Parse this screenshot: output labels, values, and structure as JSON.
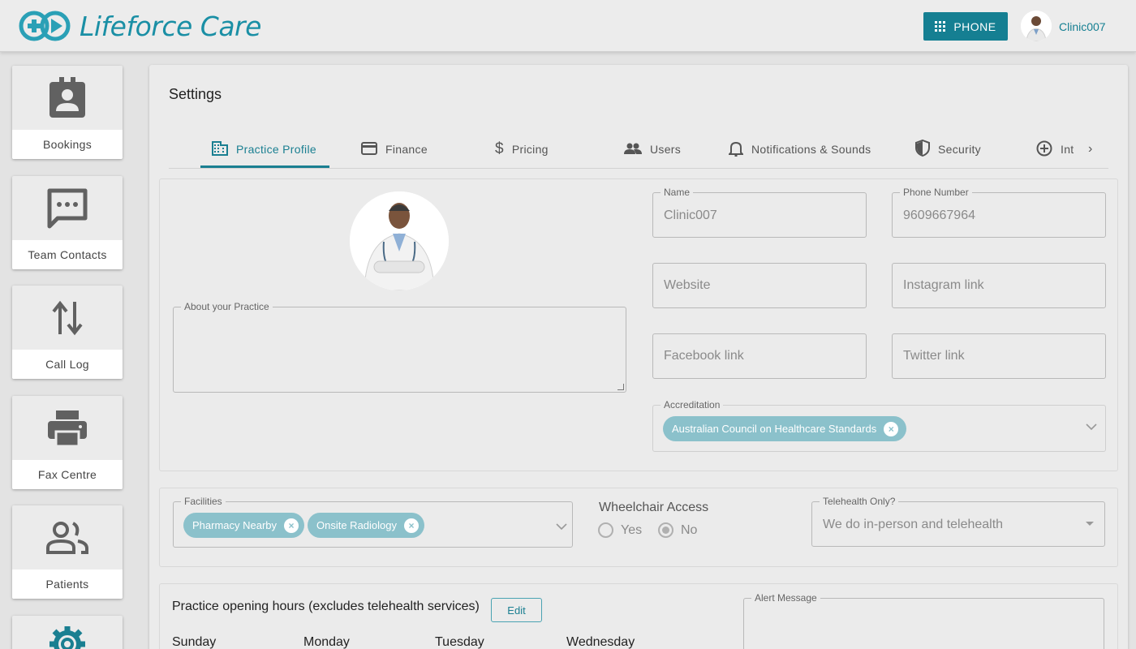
{
  "header": {
    "brand": "Lifeforce Care",
    "phone_label": "PHONE",
    "user_name": "Clinic007"
  },
  "sidebar": {
    "items": [
      {
        "label": "Bookings",
        "icon": "contact-card-icon"
      },
      {
        "label": "Team Contacts",
        "icon": "chat-bubble-icon"
      },
      {
        "label": "Call Log",
        "icon": "swap-vertical-icon"
      },
      {
        "label": "Fax Centre",
        "icon": "printer-icon"
      },
      {
        "label": "Patients",
        "icon": "people-icon"
      },
      {
        "label": "",
        "icon": "gear-icon"
      }
    ]
  },
  "settings": {
    "title": "Settings",
    "tabs": [
      {
        "label": "Practice Profile",
        "icon": "building-icon",
        "active": true
      },
      {
        "label": "Finance",
        "icon": "credit-card-icon"
      },
      {
        "label": "Pricing",
        "icon": "dollar-icon"
      },
      {
        "label": "Users",
        "icon": "users-icon"
      },
      {
        "label": "Notifications & Sounds",
        "icon": "bell-icon"
      },
      {
        "label": "Security",
        "icon": "shield-icon"
      },
      {
        "label": "Int",
        "icon": "plus-circle-icon"
      }
    ]
  },
  "profile": {
    "about_label": "About your Practice",
    "name_label": "Name",
    "name_value": "Clinic007",
    "phone_label": "Phone Number",
    "phone_value": "9609667964",
    "website_placeholder": "Website",
    "instagram_placeholder": "Instagram link",
    "facebook_placeholder": "Facebook link",
    "twitter_placeholder": "Twitter link",
    "accreditation_label": "Accreditation",
    "accreditation_chips": [
      "Australian Council on Healthcare Standards"
    ]
  },
  "facilities": {
    "label": "Facilities",
    "chips": [
      "Pharmacy Nearby",
      "Onsite Radiology"
    ],
    "wheelchair_label": "Wheelchair Access",
    "wheelchair_yes": "Yes",
    "wheelchair_no": "No",
    "wheelchair_selected": "No",
    "telehealth_label": "Telehealth Only?",
    "telehealth_value": "We do in-person and telehealth"
  },
  "hours": {
    "title": "Practice opening hours (excludes telehealth services)",
    "edit_label": "Edit",
    "days": [
      "Sunday",
      "Monday",
      "Tuesday",
      "Wednesday"
    ],
    "alert_label": "Alert Message"
  },
  "colors": {
    "accent": "#157f92",
    "brand": "#1a8fa5",
    "chip": "#8bc1cb"
  }
}
